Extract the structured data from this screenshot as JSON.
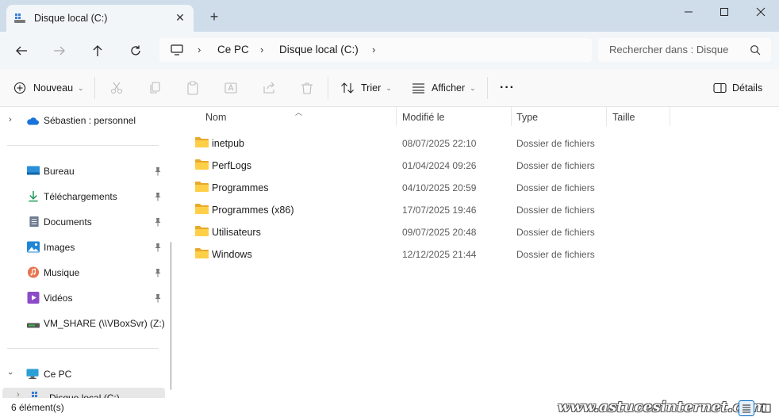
{
  "window": {
    "tab_title": "Disque local (C:)",
    "tab_close_glyph": "✕",
    "new_tab_glyph": "+",
    "accent_color": "#0067c0"
  },
  "address": {
    "crumbs": [
      "Ce PC",
      "Disque local (C:)"
    ],
    "search_placeholder": "Rechercher dans : Disque"
  },
  "toolbar": {
    "new_label": "Nouveau",
    "sort_label": "Trier",
    "view_label": "Afficher",
    "more_label": "···",
    "details_label": "Détails"
  },
  "sidebar": {
    "onedrive_label": "Sébastien : personnel",
    "quick_access": [
      {
        "label": "Bureau",
        "icon": "desktop-icon"
      },
      {
        "label": "Téléchargements",
        "icon": "downloads-icon"
      },
      {
        "label": "Documents",
        "icon": "documents-icon"
      },
      {
        "label": "Images",
        "icon": "images-icon"
      },
      {
        "label": "Musique",
        "icon": "music-icon"
      },
      {
        "label": "Vidéos",
        "icon": "videos-icon"
      }
    ],
    "share_label": "VM_SHARE (\\\\VBoxSvr) (Z:)",
    "this_pc_label": "Ce PC",
    "local_disk_label": "Disque local (C:)"
  },
  "columns": {
    "name": "Nom",
    "modified": "Modifié le",
    "type": "Type",
    "size": "Taille"
  },
  "files": [
    {
      "name": "inetpub",
      "modified": "08/07/2025 22:10",
      "type": "Dossier de fichiers"
    },
    {
      "name": "PerfLogs",
      "modified": "01/04/2024 09:26",
      "type": "Dossier de fichiers"
    },
    {
      "name": "Programmes",
      "modified": "04/10/2025 20:59",
      "type": "Dossier de fichiers"
    },
    {
      "name": "Programmes (x86)",
      "modified": "17/07/2025 19:46",
      "type": "Dossier de fichiers"
    },
    {
      "name": "Utilisateurs",
      "modified": "09/07/2025 20:48",
      "type": "Dossier de fichiers"
    },
    {
      "name": "Windows",
      "modified": "12/12/2025 21:44",
      "type": "Dossier de fichiers"
    }
  ],
  "status": {
    "count": "6 élément(s)",
    "watermark": "www.astucesinternet.com"
  }
}
